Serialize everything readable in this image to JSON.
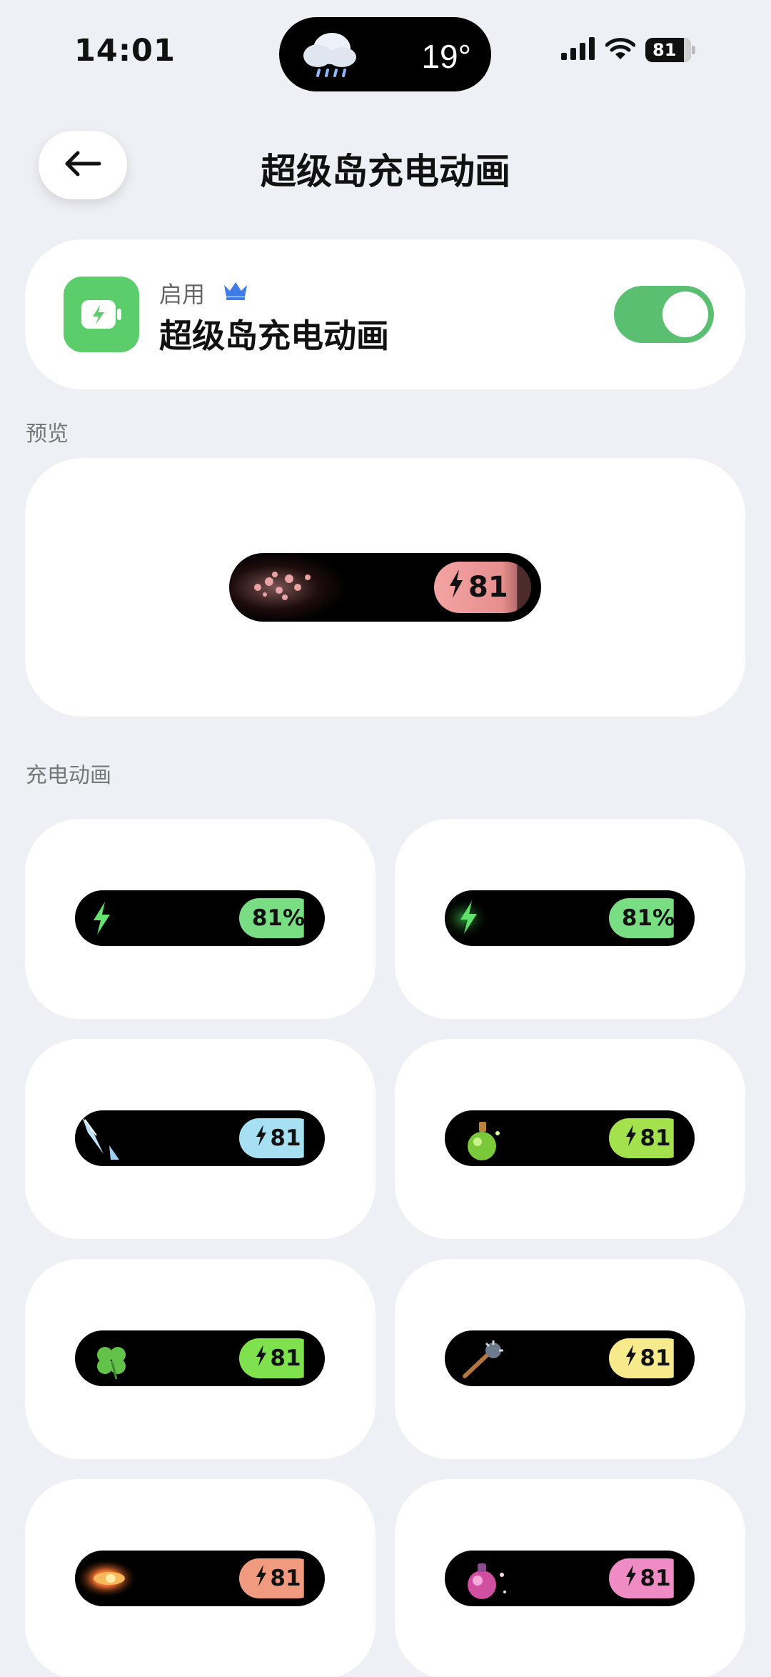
{
  "status_bar": {
    "time": "14:01",
    "weather_temp": "19°",
    "battery": "81",
    "icons": [
      "cloud-rain-icon",
      "signal-icon",
      "wifi-icon",
      "battery-icon"
    ]
  },
  "header": {
    "title": "超级岛充电动画",
    "back_icon": "arrow-left-icon"
  },
  "enable_card": {
    "label": "启用",
    "title": "超级岛充电动画",
    "toggle_on": true,
    "icon": "battery-charging-icon",
    "crown_icon": "crown-icon"
  },
  "preview": {
    "section_label": "预览",
    "battery_value": "81",
    "badge_color": "#ec9a9a"
  },
  "animations": {
    "section_label": "充电动画",
    "items": [
      {
        "badge": "81%",
        "badge_color": "#79dd83",
        "effect": "green-bolt"
      },
      {
        "badge": "81%",
        "badge_color": "#79dd83",
        "effect": "green-glow-bolt"
      },
      {
        "badge": "81",
        "badge_color": "#a7dff3",
        "effect": "ice-crystal"
      },
      {
        "badge": "81",
        "badge_color": "#a3e14d",
        "effect": "green-potion"
      },
      {
        "badge": "81",
        "badge_color": "#7fe14e",
        "effect": "four-leaf-clover"
      },
      {
        "badge": "81",
        "badge_color": "#f7ea8c",
        "effect": "spiked-mace"
      },
      {
        "badge": "81",
        "badge_color": "#f09a7f",
        "effect": "fire-eye"
      },
      {
        "badge": "81",
        "badge_color": "#ef8bc5",
        "effect": "pink-potion"
      }
    ]
  }
}
